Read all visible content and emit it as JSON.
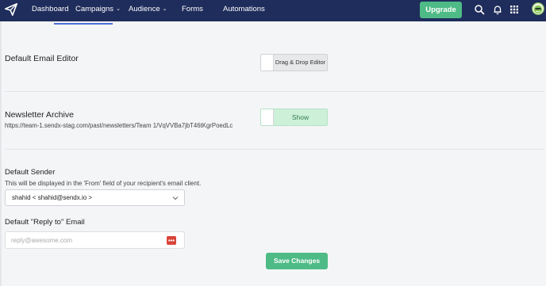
{
  "nav": {
    "items": [
      {
        "label": "Dashboard",
        "has_dropdown": false
      },
      {
        "label": "Campaigns",
        "has_dropdown": true
      },
      {
        "label": "Audience",
        "has_dropdown": true
      },
      {
        "label": "Forms",
        "has_dropdown": false
      },
      {
        "label": "Automations",
        "has_dropdown": false
      }
    ],
    "chevron": "⌄",
    "upgrade_label": "Upgrade",
    "icons": [
      "send-logo-icon",
      "search-icon",
      "bell-icon",
      "apps-grid-icon",
      "avatar"
    ]
  },
  "settings": {
    "editor": {
      "title": "Default Email Editor",
      "toggle_label": "Drag & Drop Editor"
    },
    "archive": {
      "title": "Newsletter Archive",
      "url": "https://team-1.sendx-stag.com/past/newsletters/Team 1/VqVVBa7jbT46tKgrPoedLc",
      "toggle_label": "Show"
    },
    "sender": {
      "title": "Default Sender",
      "description": "This will be displayed in the 'From' field of your recipient's email client.",
      "selected": "shahid < shahid@sendx.io >"
    },
    "reply_to": {
      "title": "Default \"Reply to\" Email",
      "placeholder": "reply@awesome.com",
      "value": ""
    },
    "save_label": "Save Changes"
  },
  "colors": {
    "navbar": "#1f2d5c",
    "accent_green": "#4ebb86",
    "active_underline": "#4a6ed8",
    "password_icon_red": "#d9443a"
  }
}
